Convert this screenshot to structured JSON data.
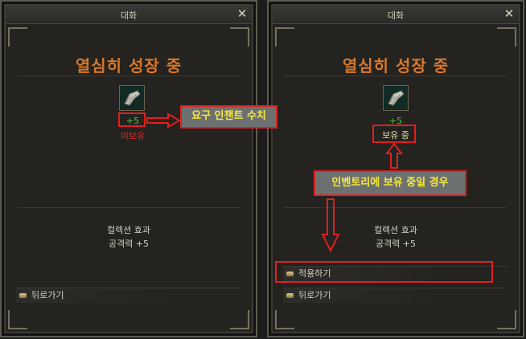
{
  "dialogs": {
    "left": {
      "window_title": "대화",
      "heading": "열심히 성장 중",
      "enchant_level": "+5",
      "ownership_status": "미보유",
      "collection_title": "컬렉션 효과",
      "collection_effect": "공격력 +5",
      "back_button": "뒤로가기"
    },
    "right": {
      "window_title": "대화",
      "heading": "열심히 성장 중",
      "enchant_level": "+5",
      "ownership_status": "보유 중",
      "collection_title": "컬렉션 효과",
      "collection_effect": "공격력 +5",
      "apply_button": "적용하기",
      "back_button": "뒤로가기"
    }
  },
  "annotations": {
    "required_enchant": "요구 인챈트 수치",
    "inventory_owned": "인벤토리에 보유 중일 경우"
  },
  "colors": {
    "heading": "#d7772b",
    "enchant_green": "#3fce3f",
    "unowned_red": "#d92a2a",
    "annotation_border": "#e02020",
    "annotation_text": "#f6ea3c"
  },
  "icons": {
    "item": "gauntlet-item-icon",
    "close": "close-icon",
    "bullet": "menu-bullet-icon"
  }
}
